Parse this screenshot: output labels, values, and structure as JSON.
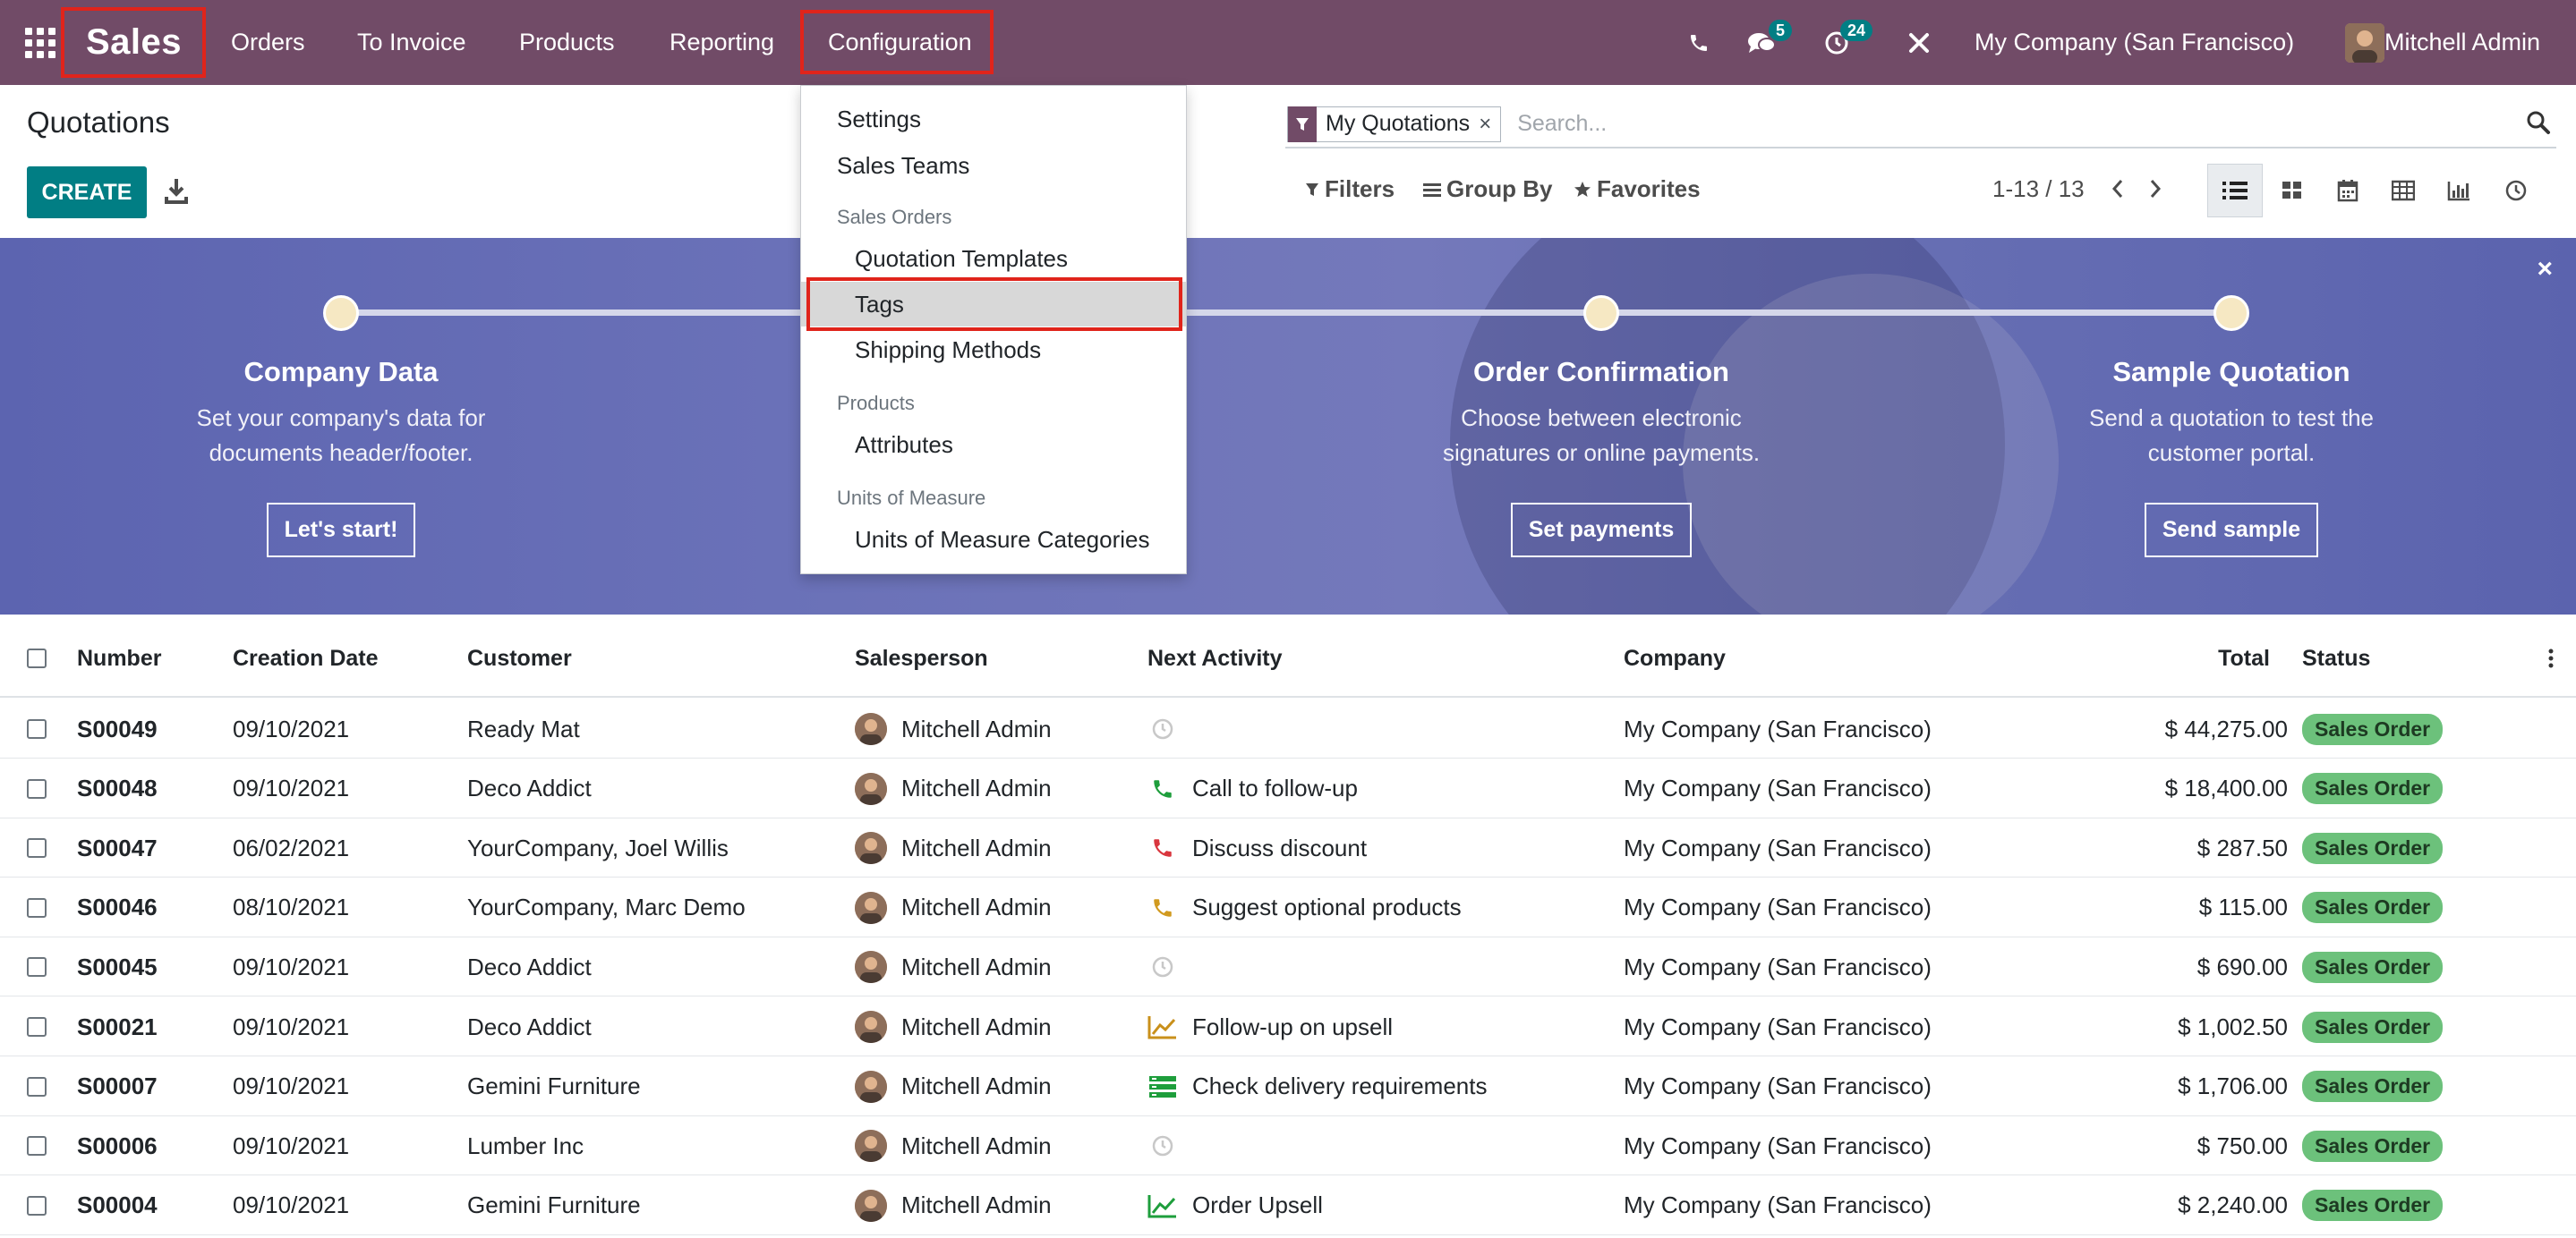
{
  "nav": {
    "brand": "Sales",
    "menu": [
      "Orders",
      "To Invoice",
      "Products",
      "Reporting",
      "Configuration"
    ],
    "messages_badge": "5",
    "activities_badge": "24",
    "company": "My Company (San Francisco)",
    "user": "Mitchell Admin"
  },
  "control": {
    "title": "Quotations",
    "create_label": "CREATE",
    "facet_label": "My Quotations",
    "facet_remove": "×",
    "search_placeholder": "Search...",
    "filters_label": "Filters",
    "groupby_label": "Group By",
    "favorites_label": "Favorites",
    "pager": "1-13 / 13"
  },
  "banner": {
    "close": "×",
    "steps": [
      {
        "title": "Company Data",
        "desc1": "Set your company's data for",
        "desc2": "documents header/footer.",
        "button": "Let's start!"
      },
      {
        "title": "Order Confirmation",
        "desc1": "Choose between electronic",
        "desc2": "signatures or online payments.",
        "button": "Set payments"
      },
      {
        "title": "Sample Quotation",
        "desc1": "Send a quotation to test the",
        "desc2": "customer portal.",
        "button": "Send sample"
      }
    ]
  },
  "dropdown": {
    "settings": "Settings",
    "sales_teams": "Sales Teams",
    "sales_orders_header": "Sales Orders",
    "quotation_templates": "Quotation Templates",
    "tags": "Tags",
    "shipping_methods": "Shipping Methods",
    "products_header": "Products",
    "attributes": "Attributes",
    "uom_header": "Units of Measure",
    "uom_categories": "Units of Measure Categories"
  },
  "table": {
    "headers": {
      "number": "Number",
      "creation_date": "Creation Date",
      "customer": "Customer",
      "salesperson": "Salesperson",
      "next_activity": "Next Activity",
      "company": "Company",
      "total": "Total",
      "status": "Status"
    },
    "rows": [
      {
        "number": "S00049",
        "date": "09/10/2021",
        "customer": "Ready Mat",
        "salesperson": "Mitchell Admin",
        "activity": "",
        "activity_icon": "clock-icon",
        "company": "My Company (San Francisco)",
        "total": "$ 44,275.00",
        "status": "Sales Order"
      },
      {
        "number": "S00048",
        "date": "09/10/2021",
        "customer": "Deco Addict",
        "salesperson": "Mitchell Admin",
        "activity": "Call to follow-up",
        "activity_icon": "phone-green-icon",
        "company": "My Company (San Francisco)",
        "total": "$ 18,400.00",
        "status": "Sales Order"
      },
      {
        "number": "S00047",
        "date": "06/02/2021",
        "customer": "YourCompany, Joel Willis",
        "salesperson": "Mitchell Admin",
        "activity": "Discuss discount",
        "activity_icon": "phone-red-icon",
        "company": "My Company (San Francisco)",
        "total": "$ 287.50",
        "status": "Sales Order"
      },
      {
        "number": "S00046",
        "date": "08/10/2021",
        "customer": "YourCompany, Marc Demo",
        "salesperson": "Mitchell Admin",
        "activity": "Suggest optional products",
        "activity_icon": "phone-orange-icon",
        "company": "My Company (San Francisco)",
        "total": "$ 115.00",
        "status": "Sales Order"
      },
      {
        "number": "S00045",
        "date": "09/10/2021",
        "customer": "Deco Addict",
        "salesperson": "Mitchell Admin",
        "activity": "",
        "activity_icon": "clock-icon",
        "company": "My Company (San Francisco)",
        "total": "$ 690.00",
        "status": "Sales Order"
      },
      {
        "number": "S00021",
        "date": "09/10/2021",
        "customer": "Deco Addict",
        "salesperson": "Mitchell Admin",
        "activity": "Follow-up on upsell",
        "activity_icon": "chart-orange-icon",
        "company": "My Company (San Francisco)",
        "total": "$ 1,002.50",
        "status": "Sales Order"
      },
      {
        "number": "S00007",
        "date": "09/10/2021",
        "customer": "Gemini Furniture",
        "salesperson": "Mitchell Admin",
        "activity": "Check delivery requirements",
        "activity_icon": "tasks-green-icon",
        "company": "My Company (San Francisco)",
        "total": "$ 1,706.00",
        "status": "Sales Order"
      },
      {
        "number": "S00006",
        "date": "09/10/2021",
        "customer": "Lumber Inc",
        "salesperson": "Mitchell Admin",
        "activity": "",
        "activity_icon": "clock-icon",
        "company": "My Company (San Francisco)",
        "total": "$ 750.00",
        "status": "Sales Order"
      },
      {
        "number": "S00004",
        "date": "09/10/2021",
        "customer": "Gemini Furniture",
        "salesperson": "Mitchell Admin",
        "activity": "Order Upsell",
        "activity_icon": "chart-green-icon",
        "company": "My Company (San Francisco)",
        "total": "$ 2,240.00",
        "status": "Sales Order"
      }
    ]
  },
  "colors": {
    "navbar": "#714b67",
    "primary": "#017e84",
    "highlight": "#e0241b",
    "status_pill": "#6cc17b"
  }
}
